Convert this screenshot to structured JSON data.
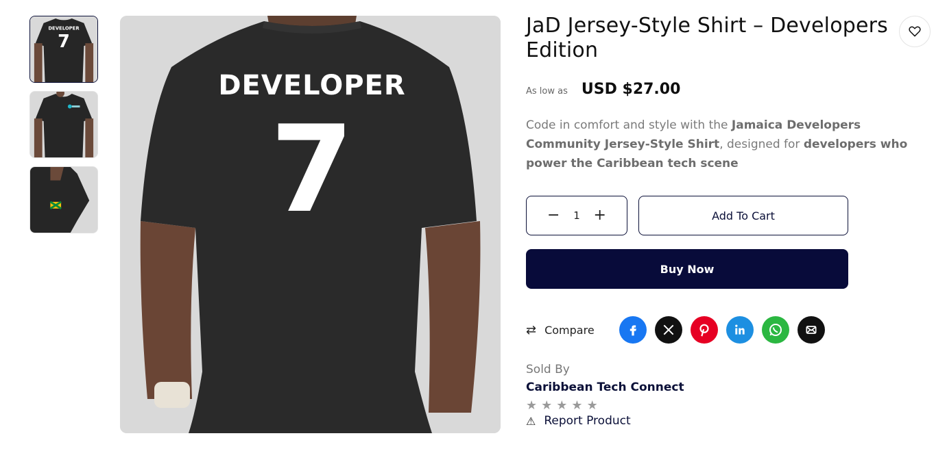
{
  "gallery": {
    "thumbnails": [
      {
        "alt": "Back view",
        "shirt_text": "DEVELOPER",
        "shirt_number": "7"
      },
      {
        "alt": "Front view"
      },
      {
        "alt": "Sleeve view"
      }
    ],
    "main": {
      "shirt_text": "DEVELOPER",
      "shirt_number": "7"
    }
  },
  "product": {
    "title": "JaD Jersey-Style Shirt – Developers Edition",
    "price_prefix": "As low as",
    "price": "USD $27.00",
    "description": {
      "p1": "Code in comfort and style with the ",
      "b1": "Jamaica Developers Community Jersey-Style Shirt",
      "p2": ", designed for ",
      "b2": "developers who power the Caribbean tech scene"
    }
  },
  "cart": {
    "minus": "−",
    "quantity": "1",
    "plus": "+",
    "add_to_cart": "Add To Cart",
    "buy_now": "Buy Now"
  },
  "actions": {
    "compare": "Compare",
    "socials": [
      {
        "name": "facebook",
        "color": "#1877f2"
      },
      {
        "name": "x",
        "color": "#111111"
      },
      {
        "name": "pinterest",
        "color": "#e60023"
      },
      {
        "name": "linkedin",
        "color": "#1d8fe1"
      },
      {
        "name": "whatsapp",
        "color": "#2bb741"
      },
      {
        "name": "email",
        "color": "#111111"
      }
    ]
  },
  "seller": {
    "label": "Sold By",
    "name": "Caribbean Tech Connect",
    "rating": 0,
    "max_rating": 5,
    "report": "Report Product"
  },
  "colors": {
    "brand": "#080b3a",
    "shirt": "#2a2a2a",
    "background": "#d9d9d9"
  }
}
